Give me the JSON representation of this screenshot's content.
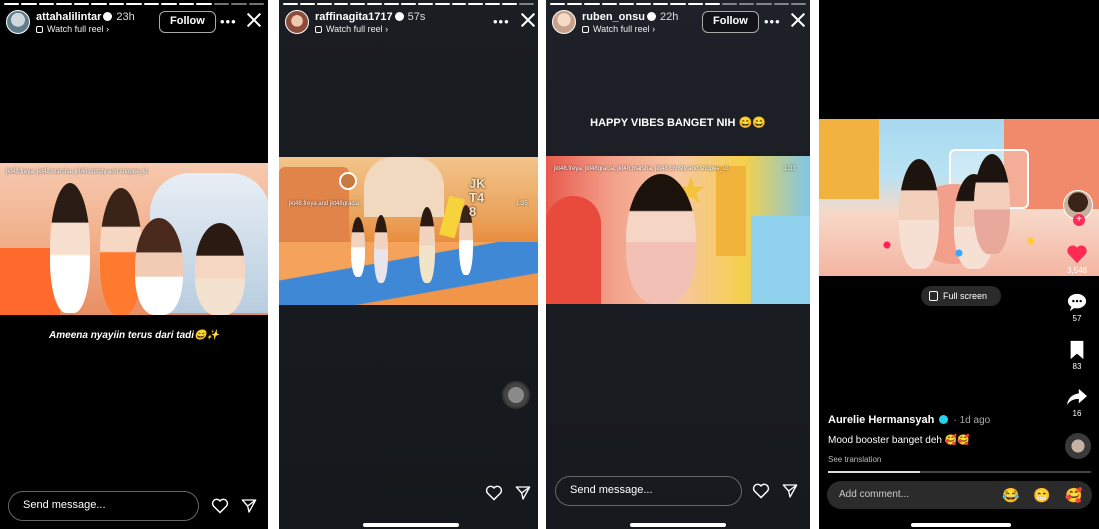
{
  "panels": [
    {
      "username": "attahalilintar",
      "time": "23h",
      "subline": "Watch full reel ›",
      "follow_label": "Follow",
      "video_tags": "jkt48.freya, jkt48.marsha, jkt48.christy and shopee_id",
      "caption": "Ameena nyayiin terus dari tadi😄✨",
      "message_placeholder": "Send message..."
    },
    {
      "username": "raffinagita1717",
      "time": "57s",
      "subline": "Watch full reel ›",
      "video_tags": "jkt48.freya and jkt48gracia",
      "video_time": "1:35",
      "video_logo": "JKT48"
    },
    {
      "username": "ruben_onsu",
      "time": "22h",
      "subline": "Watch full reel ›",
      "follow_label": "Follow",
      "caption": "HAPPY VIBES BANGET NIH 😄😄",
      "video_tags": "jkt48.freya, jkt48gracia, jkt48.marsha, jkt48.christy and shopee_id",
      "video_time": "1:33",
      "message_placeholder": "Send message..."
    },
    {
      "fullscreen_label": "Full screen",
      "comments_count": "57",
      "saves_count": "83",
      "shares_count": "16",
      "likes_count": "3,548",
      "author": "Aurelie Hermansyah",
      "author_time": "· 1d ago",
      "description": "Mood booster banget deh 🥰🥰",
      "translation": "See translation",
      "comment_placeholder": "Add comment...",
      "quick_emojis": [
        "😂",
        "😁",
        "🥰"
      ]
    }
  ],
  "colors": {
    "background": "#000000",
    "accent_red": "#fe2c55",
    "verified_blue": "#20d5ec"
  }
}
